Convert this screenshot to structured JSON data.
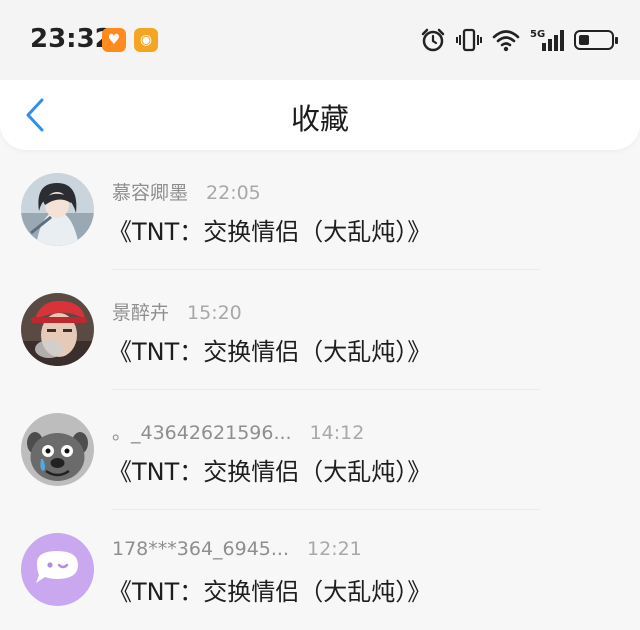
{
  "status_bar": {
    "time": "23:32",
    "apps": [
      "taobao-icon",
      "weibo-icon"
    ],
    "network": "5G"
  },
  "nav": {
    "title": "收藏",
    "back_icon": "chevron-left-icon",
    "accent_color": "#2e8ff0"
  },
  "items": [
    {
      "name": "慕容卿墨",
      "time": "22:05",
      "message": "《TNT：交换情侣（大乱炖）》",
      "avatar": "anime-girl-avatar"
    },
    {
      "name": "景醉卉",
      "time": "15:20",
      "message": "《TNT：交换情侣（大乱炖）》",
      "avatar": "person-red-cap-avatar"
    },
    {
      "name": "。_43642621596...",
      "time": "14:12",
      "message": "《TNT：交换情侣（大乱炖）》",
      "avatar": "gray-dog-avatar"
    },
    {
      "name": "178***364_6945...",
      "time": "12:21",
      "message": "《TNT：交换情侣（大乱炖）》",
      "avatar": "purple-chat-avatar"
    }
  ]
}
